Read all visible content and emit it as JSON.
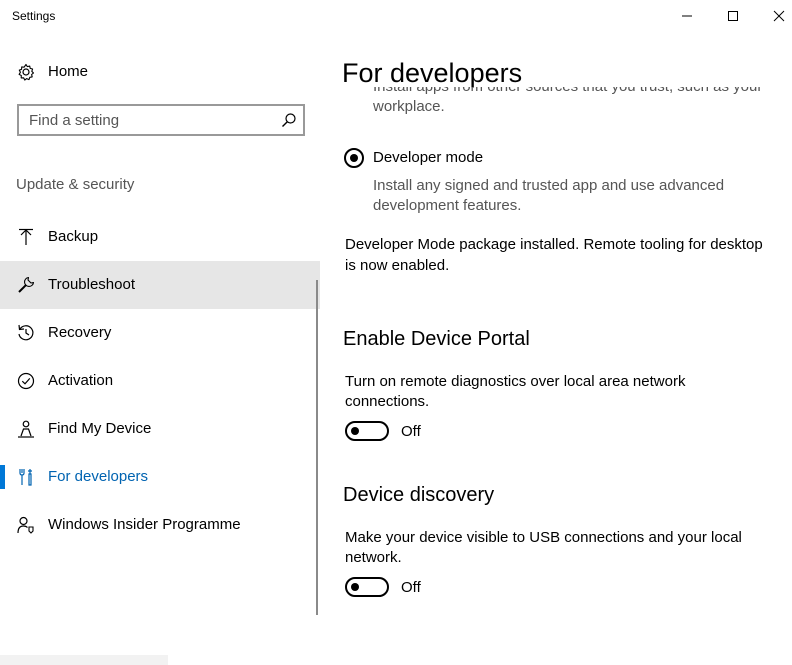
{
  "window": {
    "title": "Settings"
  },
  "sidebar": {
    "home_label": "Home",
    "search_placeholder": "Find a setting",
    "section_label": "Update & security",
    "items": [
      {
        "label": "Backup",
        "icon": "backup-arrow-icon"
      },
      {
        "label": "Troubleshoot",
        "icon": "wrench-icon"
      },
      {
        "label": "Recovery",
        "icon": "recovery-icon"
      },
      {
        "label": "Activation",
        "icon": "checkmark-circle-icon"
      },
      {
        "label": "Find My Device",
        "icon": "person-location-icon"
      },
      {
        "label": "For developers",
        "icon": "developer-tools-icon"
      },
      {
        "label": "Windows Insider Programme",
        "icon": "insider-icon"
      }
    ],
    "selected_item": "Troubleshoot",
    "current_item": "For developers"
  },
  "content": {
    "page_title": "For developers",
    "cut_text": "Install apps from other sources that you trust, such as your workplace.",
    "developer_mode": {
      "label": "Developer mode",
      "description": "Install any signed and trusted app and use advanced development features.",
      "selected": true
    },
    "status_text": "Developer Mode package installed. Remote tooling for desktop is now enabled.",
    "device_portal": {
      "heading": "Enable Device Portal",
      "description": "Turn on remote diagnostics over local area network connections.",
      "toggle_label": "Off"
    },
    "device_discovery": {
      "heading": "Device discovery",
      "description": "Make your device visible to USB connections and your local network.",
      "toggle_label": "Off"
    }
  },
  "colors": {
    "accent": "#0078d7",
    "selected_bg": "#e6e6e6",
    "secondary_text": "#555555"
  }
}
